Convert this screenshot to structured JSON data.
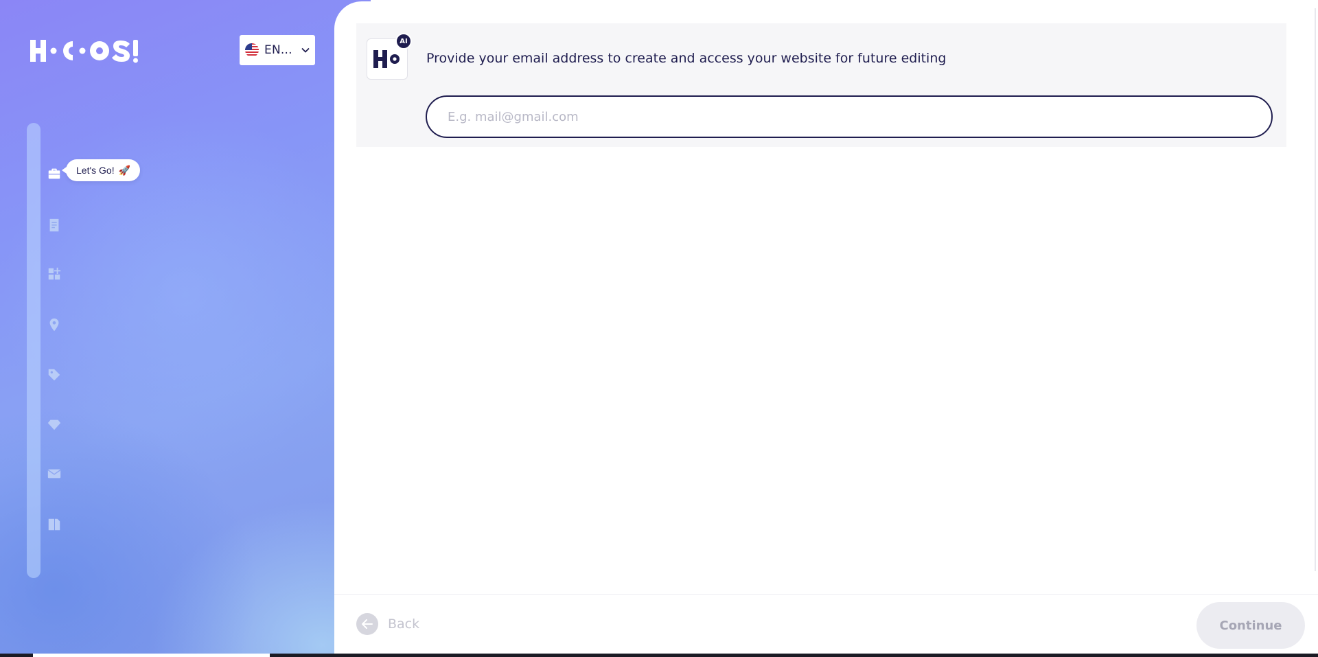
{
  "brand": {
    "logo_text": "HOCOOS"
  },
  "language": {
    "selected": "EN...",
    "flag_icon": "us-flag-icon"
  },
  "stepper": {
    "tooltip": "Let's Go!",
    "tooltip_emoji": "🚀",
    "steps": [
      {
        "icon": "briefcase-icon",
        "active": true
      },
      {
        "icon": "document-icon",
        "active": false
      },
      {
        "icon": "widgets-add-icon",
        "active": false
      },
      {
        "icon": "location-pin-icon",
        "active": false
      },
      {
        "icon": "tag-icon",
        "active": false
      },
      {
        "icon": "diamond-icon",
        "active": false
      },
      {
        "icon": "envelope-icon",
        "active": false
      },
      {
        "icon": "pages-icon",
        "active": false
      }
    ]
  },
  "question": {
    "avatar_badge": "AI",
    "text": "Provide your email address to create and access your website for future editing",
    "email_placeholder": "E.g. mail@gmail.com",
    "email_value": ""
  },
  "footer": {
    "back_label": "Back",
    "continue_label": "Continue"
  },
  "colors": {
    "navy": "#1f1d4f",
    "panel_gradient_start": "#8b86f6",
    "panel_gradient_end": "#7f98ea",
    "muted": "#c4c4cf",
    "disabled_button_bg": "#ececf1"
  }
}
